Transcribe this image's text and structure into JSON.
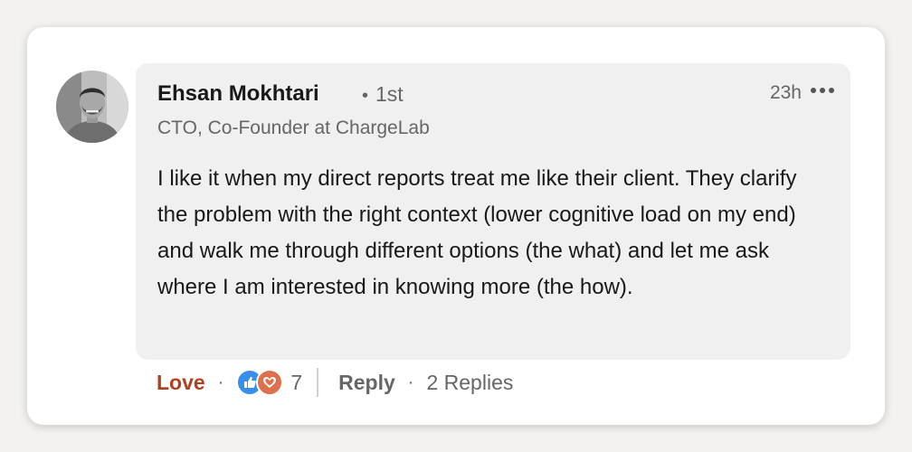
{
  "comment": {
    "author": {
      "name": "Ehsan Mokhtari",
      "degree": "1st",
      "headline": "CTO, Co-Founder at ChargeLab",
      "avatar": "profile-photo"
    },
    "timestamp": "23h",
    "menu_icon": "more-horizontal-icon",
    "text": "I like it when my direct reports treat me like their client. They clarify the problem with the right context (lower cognitive load on my end) and walk me through different options (the what) and let me ask where I am interested in knowing more (the how)."
  },
  "actions": {
    "reaction_label": "Love",
    "reaction_icons": [
      "like-icon",
      "love-icon"
    ],
    "reaction_count": "7",
    "reply_label": "Reply",
    "replies_label": "2 Replies"
  },
  "colors": {
    "love_accent": "#b24020",
    "like_blue": "#378fe9",
    "love_orange": "#df704d",
    "bubble_bg": "#f0f0f0"
  }
}
